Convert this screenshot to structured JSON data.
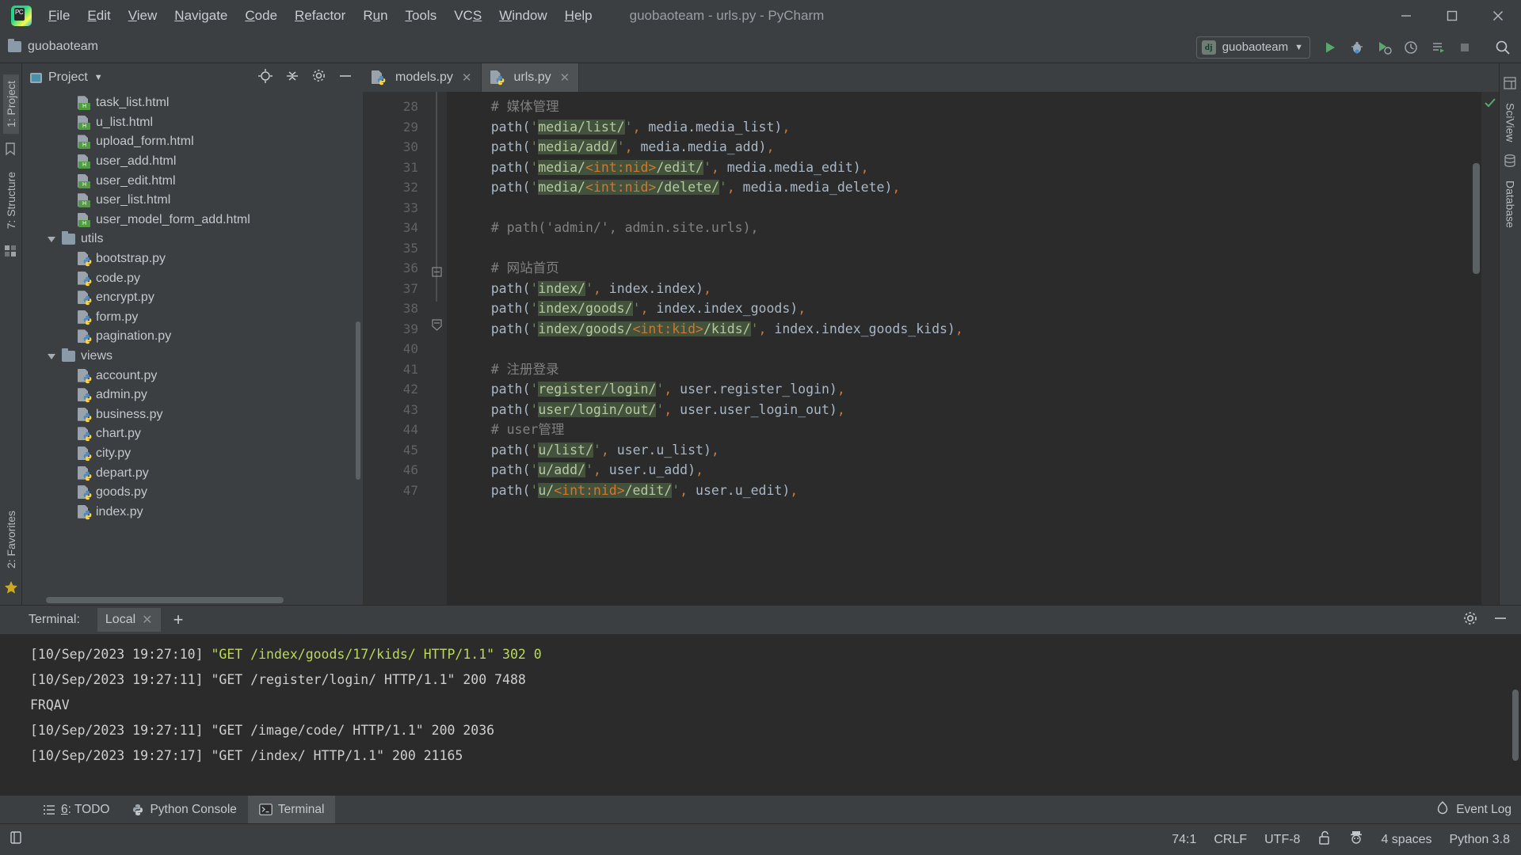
{
  "window": {
    "title": "guobaoteam - urls.py - PyCharm",
    "app_icon": "pycharm-logo-icon",
    "controls": {
      "minimize": "minimize-icon",
      "maximize": "maximize-icon",
      "close": "close-icon"
    }
  },
  "menubar": {
    "items": [
      {
        "label": "File",
        "mnemonic": "F"
      },
      {
        "label": "Edit",
        "mnemonic": "E"
      },
      {
        "label": "View",
        "mnemonic": "V"
      },
      {
        "label": "Navigate",
        "mnemonic": "N"
      },
      {
        "label": "Code",
        "mnemonic": "C"
      },
      {
        "label": "Refactor",
        "mnemonic": "R"
      },
      {
        "label": "Run",
        "mnemonic": "u"
      },
      {
        "label": "Tools",
        "mnemonic": "T"
      },
      {
        "label": "VCS",
        "mnemonic": "S"
      },
      {
        "label": "Window",
        "mnemonic": "W"
      },
      {
        "label": "Help",
        "mnemonic": "H"
      }
    ]
  },
  "toolbar": {
    "breadcrumb": "guobaoteam",
    "run_config": "guobaoteam",
    "run_config_badge": "dj",
    "buttons": [
      "run-icon",
      "debug-icon",
      "run-coverage-icon",
      "profile-icon",
      "run-with-console-icon",
      "stop-icon",
      "search-everywhere-icon"
    ]
  },
  "left_rail": {
    "items": [
      {
        "label": "1: Project",
        "name": "tool-project",
        "active": true
      },
      {
        "label": "7: Structure",
        "name": "tool-structure",
        "active": false
      }
    ],
    "bottom_items": [
      {
        "label": "2: Favorites",
        "name": "tool-favorites"
      }
    ]
  },
  "right_rail": {
    "items": [
      {
        "label": "SciView",
        "name": "tool-sciview"
      },
      {
        "label": "Database",
        "name": "tool-database"
      }
    ]
  },
  "project": {
    "panel_title": "Project",
    "actions": [
      "locate-icon",
      "collapse-all-icon",
      "settings-icon",
      "hide-icon"
    ],
    "tree": [
      {
        "label": "task_list.html",
        "type": "html",
        "indent": 3
      },
      {
        "label": "u_list.html",
        "type": "html",
        "indent": 3
      },
      {
        "label": "upload_form.html",
        "type": "html",
        "indent": 3
      },
      {
        "label": "user_add.html",
        "type": "html",
        "indent": 3
      },
      {
        "label": "user_edit.html",
        "type": "html",
        "indent": 3
      },
      {
        "label": "user_list.html",
        "type": "html",
        "indent": 3
      },
      {
        "label": "user_model_form_add.html",
        "type": "html",
        "indent": 3
      },
      {
        "label": "utils",
        "type": "folder",
        "indent": 2,
        "expanded": true
      },
      {
        "label": "bootstrap.py",
        "type": "py",
        "indent": 3
      },
      {
        "label": "code.py",
        "type": "py",
        "indent": 3
      },
      {
        "label": "encrypt.py",
        "type": "py",
        "indent": 3
      },
      {
        "label": "form.py",
        "type": "py",
        "indent": 3
      },
      {
        "label": "pagination.py",
        "type": "py",
        "indent": 3
      },
      {
        "label": "views",
        "type": "folder",
        "indent": 2,
        "expanded": true
      },
      {
        "label": "account.py",
        "type": "py",
        "indent": 3
      },
      {
        "label": "admin.py",
        "type": "py",
        "indent": 3
      },
      {
        "label": "business.py",
        "type": "py",
        "indent": 3
      },
      {
        "label": "chart.py",
        "type": "py",
        "indent": 3
      },
      {
        "label": "city.py",
        "type": "py",
        "indent": 3
      },
      {
        "label": "depart.py",
        "type": "py",
        "indent": 3
      },
      {
        "label": "goods.py",
        "type": "py",
        "indent": 3
      },
      {
        "label": "index.py",
        "type": "py",
        "indent": 3
      }
    ]
  },
  "editor": {
    "tabs": [
      {
        "label": "models.py",
        "type": "py",
        "active": false
      },
      {
        "label": "urls.py",
        "type": "py",
        "active": true
      }
    ],
    "first_line": 28,
    "lines": [
      {
        "n": 28,
        "segments": [
          {
            "t": "    # 媒体管理",
            "c": "cm"
          }
        ]
      },
      {
        "n": 29,
        "segments": [
          {
            "t": "    path(",
            "c": "fn"
          },
          {
            "t": "'",
            "c": "q"
          },
          {
            "t": "media/list/",
            "c": "strlit"
          },
          {
            "t": "'",
            "c": "q"
          },
          {
            "t": ",",
            "c": "comma"
          },
          {
            "t": " media.media_list)",
            "c": "fn"
          },
          {
            "t": ",",
            "c": "comma"
          }
        ]
      },
      {
        "n": 30,
        "segments": [
          {
            "t": "    path(",
            "c": "fn"
          },
          {
            "t": "'",
            "c": "q"
          },
          {
            "t": "media/add/",
            "c": "strlit"
          },
          {
            "t": "'",
            "c": "q"
          },
          {
            "t": ",",
            "c": "comma"
          },
          {
            "t": " media.media_add)",
            "c": "fn"
          },
          {
            "t": ",",
            "c": "comma"
          }
        ]
      },
      {
        "n": 31,
        "segments": [
          {
            "t": "    path(",
            "c": "fn"
          },
          {
            "t": "'",
            "c": "q"
          },
          {
            "t": "media/",
            "c": "strlit"
          },
          {
            "t": "<int:nid>",
            "c": "param"
          },
          {
            "t": "/edit/",
            "c": "strlit"
          },
          {
            "t": "'",
            "c": "q"
          },
          {
            "t": ",",
            "c": "comma"
          },
          {
            "t": " media.media_edit)",
            "c": "fn"
          },
          {
            "t": ",",
            "c": "comma"
          }
        ]
      },
      {
        "n": 32,
        "segments": [
          {
            "t": "    path(",
            "c": "fn"
          },
          {
            "t": "'",
            "c": "q"
          },
          {
            "t": "media/",
            "c": "strlit"
          },
          {
            "t": "<int:nid>",
            "c": "param"
          },
          {
            "t": "/delete/",
            "c": "strlit"
          },
          {
            "t": "'",
            "c": "q"
          },
          {
            "t": ",",
            "c": "comma"
          },
          {
            "t": " media.media_delete)",
            "c": "fn"
          },
          {
            "t": ",",
            "c": "comma"
          }
        ]
      },
      {
        "n": 33,
        "segments": [
          {
            "t": "",
            "c": "fn"
          }
        ]
      },
      {
        "n": 34,
        "segments": [
          {
            "t": "    # path('admin/', admin.site.urls),",
            "c": "cm"
          }
        ]
      },
      {
        "n": 35,
        "segments": [
          {
            "t": "",
            "c": "fn"
          }
        ]
      },
      {
        "n": 36,
        "segments": [
          {
            "t": "    # 网站首页",
            "c": "cm"
          }
        ]
      },
      {
        "n": 37,
        "segments": [
          {
            "t": "    path(",
            "c": "fn"
          },
          {
            "t": "'",
            "c": "q"
          },
          {
            "t": "index/",
            "c": "strlit"
          },
          {
            "t": "'",
            "c": "q"
          },
          {
            "t": ",",
            "c": "comma"
          },
          {
            "t": " index.index)",
            "c": "fn"
          },
          {
            "t": ",",
            "c": "comma"
          }
        ]
      },
      {
        "n": 38,
        "segments": [
          {
            "t": "    path(",
            "c": "fn"
          },
          {
            "t": "'",
            "c": "q"
          },
          {
            "t": "index/goods/",
            "c": "strlit"
          },
          {
            "t": "'",
            "c": "q"
          },
          {
            "t": ",",
            "c": "comma"
          },
          {
            "t": " index.index_goods)",
            "c": "fn"
          },
          {
            "t": ",",
            "c": "comma"
          }
        ]
      },
      {
        "n": 39,
        "segments": [
          {
            "t": "    path(",
            "c": "fn"
          },
          {
            "t": "'",
            "c": "q"
          },
          {
            "t": "index/goods/",
            "c": "strlit"
          },
          {
            "t": "<int:kid>",
            "c": "param"
          },
          {
            "t": "/kids/",
            "c": "strlit"
          },
          {
            "t": "'",
            "c": "q"
          },
          {
            "t": ",",
            "c": "comma"
          },
          {
            "t": " index.index_goods_kids)",
            "c": "fn"
          },
          {
            "t": ",",
            "c": "comma"
          }
        ]
      },
      {
        "n": 40,
        "segments": [
          {
            "t": "",
            "c": "fn"
          }
        ]
      },
      {
        "n": 41,
        "segments": [
          {
            "t": "    # 注册登录",
            "c": "cm"
          }
        ]
      },
      {
        "n": 42,
        "segments": [
          {
            "t": "    path(",
            "c": "fn"
          },
          {
            "t": "'",
            "c": "q"
          },
          {
            "t": "register/login/",
            "c": "strlit"
          },
          {
            "t": "'",
            "c": "q"
          },
          {
            "t": ",",
            "c": "comma"
          },
          {
            "t": " user.register_login)",
            "c": "fn"
          },
          {
            "t": ",",
            "c": "comma"
          }
        ]
      },
      {
        "n": 43,
        "segments": [
          {
            "t": "    path(",
            "c": "fn"
          },
          {
            "t": "'",
            "c": "q"
          },
          {
            "t": "user/login/out/",
            "c": "strlit"
          },
          {
            "t": "'",
            "c": "q"
          },
          {
            "t": ",",
            "c": "comma"
          },
          {
            "t": " user.user_login_out)",
            "c": "fn"
          },
          {
            "t": ",",
            "c": "comma"
          }
        ]
      },
      {
        "n": 44,
        "segments": [
          {
            "t": "    # user管理",
            "c": "cm"
          }
        ]
      },
      {
        "n": 45,
        "segments": [
          {
            "t": "    path(",
            "c": "fn"
          },
          {
            "t": "'",
            "c": "q"
          },
          {
            "t": "u/list/",
            "c": "strlit"
          },
          {
            "t": "'",
            "c": "q"
          },
          {
            "t": ",",
            "c": "comma"
          },
          {
            "t": " user.u_list)",
            "c": "fn"
          },
          {
            "t": ",",
            "c": "comma"
          }
        ]
      },
      {
        "n": 46,
        "segments": [
          {
            "t": "    path(",
            "c": "fn"
          },
          {
            "t": "'",
            "c": "q"
          },
          {
            "t": "u/add/",
            "c": "strlit"
          },
          {
            "t": "'",
            "c": "q"
          },
          {
            "t": ",",
            "c": "comma"
          },
          {
            "t": " user.u_add)",
            "c": "fn"
          },
          {
            "t": ",",
            "c": "comma"
          }
        ]
      },
      {
        "n": 47,
        "segments": [
          {
            "t": "    path(",
            "c": "fn"
          },
          {
            "t": "'",
            "c": "q"
          },
          {
            "t": "u/",
            "c": "strlit"
          },
          {
            "t": "<int:nid>",
            "c": "param"
          },
          {
            "t": "/edit/",
            "c": "strlit"
          },
          {
            "t": "'",
            "c": "q"
          },
          {
            "t": ",",
            "c": "comma"
          },
          {
            "t": " user.u_edit)",
            "c": "fn"
          },
          {
            "t": ",",
            "c": "comma"
          }
        ]
      }
    ]
  },
  "terminal": {
    "label": "Terminal:",
    "tab": "Local",
    "add_button": "add-tab-icon",
    "actions": [
      "settings-icon",
      "hide-icon"
    ],
    "output": [
      {
        "text": "[10/Sep/2023 19:27:10] ",
        "rest": "\"GET /index/goods/17/kids/ HTTP/1.1\" 302 0",
        "highlight": true
      },
      {
        "text": "[10/Sep/2023 19:27:11] ",
        "rest": "\"GET /register/login/ HTTP/1.1\" 200 7488",
        "highlight": false
      },
      {
        "text": "FRQAV",
        "rest": "",
        "highlight": false
      },
      {
        "text": "[10/Sep/2023 19:27:11] ",
        "rest": "\"GET /image/code/ HTTP/1.1\" 200 2036",
        "highlight": false
      },
      {
        "text": "[10/Sep/2023 19:27:17] ",
        "rest": "\"GET /index/ HTTP/1.1\" 200 21165",
        "highlight": false
      }
    ]
  },
  "toolwindow_bar": {
    "tabs": [
      {
        "label": "6: TODO",
        "icon": "todo-icon",
        "active": false
      },
      {
        "label": "Python Console",
        "icon": "python-icon",
        "active": false
      },
      {
        "label": "Terminal",
        "icon": "terminal-icon",
        "active": true
      }
    ],
    "event_log": "Event Log",
    "event_log_icon": "event-log-icon"
  },
  "statusbar": {
    "caret": "74:1",
    "line_separator": "CRLF",
    "encoding": "UTF-8",
    "lock_icon": "unlocked-icon",
    "inspection_icon": "hector-icon",
    "indent": "4 spaces",
    "interpreter": "Python 3.8"
  },
  "colors": {
    "accent_green": "#bada55",
    "string_highlight": "#43523c",
    "panel_bg": "#3c3f41",
    "editor_bg": "#2b2b2b",
    "gutter_bg": "#313335"
  }
}
